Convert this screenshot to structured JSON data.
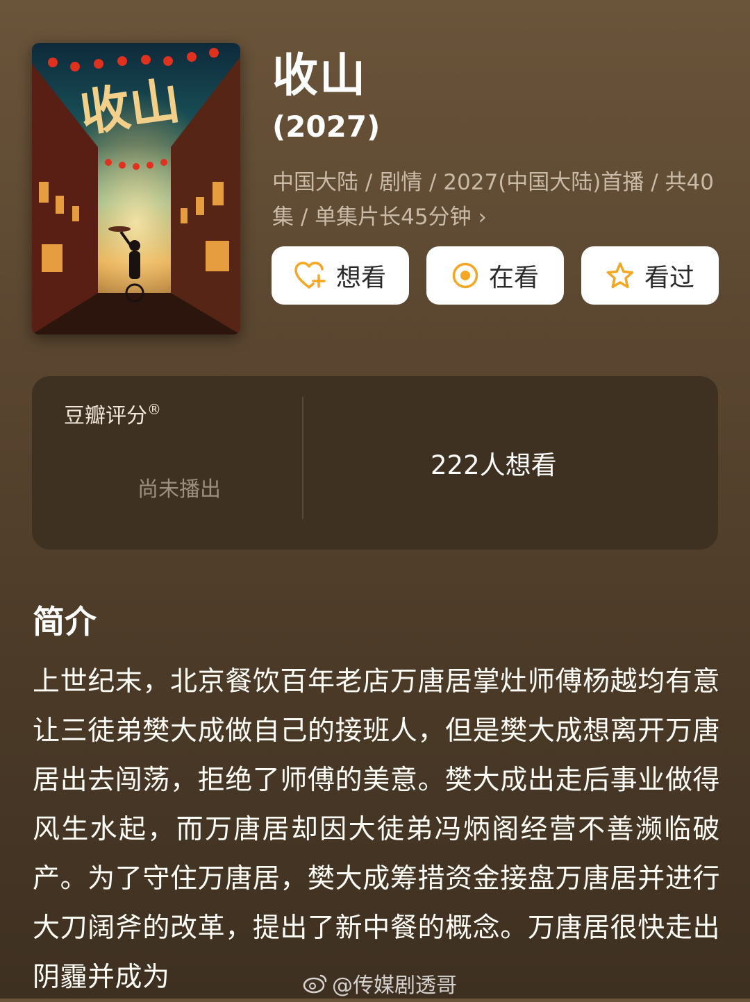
{
  "show": {
    "title": "收山",
    "year": "(2027)",
    "meta_line": "中国大陆 / 剧情 / 2027(中国大陆)首播 / 共40集 / 单集片长45分钟",
    "meta_chevron": "›"
  },
  "poster": {
    "title_art": "收山",
    "description": "poster-art"
  },
  "actions": {
    "want": {
      "label": "想看",
      "icon": "heart-plus-icon",
      "color": "#f5a623"
    },
    "watching": {
      "label": "在看",
      "icon": "target-circle-icon",
      "color": "#f5a623"
    },
    "watched": {
      "label": "看过",
      "icon": "star-icon",
      "color": "#f5a623"
    }
  },
  "rating": {
    "label": "豆瓣评分",
    "registered_mark": "®",
    "status": "尚未播出",
    "want_count": "222人想看"
  },
  "synopsis": {
    "heading": "简介",
    "text": "上世纪末，北京餐饮百年老店万唐居掌灶师傅杨越均有意让三徒弟樊大成做自己的接班人，但是樊大成想离开万唐居出去闯荡，拒绝了师傅的美意。樊大成出走后事业做得风生水起，而万唐居却因大徒弟冯炳阁经营不善濒临破产。为了守住万唐居，樊大成筹措资金接盘万唐居并进行大刀阔斧的改革，提出了新中餐的概念。万唐居很快走出阴霾并成为"
  },
  "watermark": {
    "text": "@传媒剧透哥"
  },
  "colors": {
    "accent": "#f5a623",
    "panel": "#3f3122",
    "background_top": "#6a543a",
    "background_bottom": "#3e3021"
  }
}
